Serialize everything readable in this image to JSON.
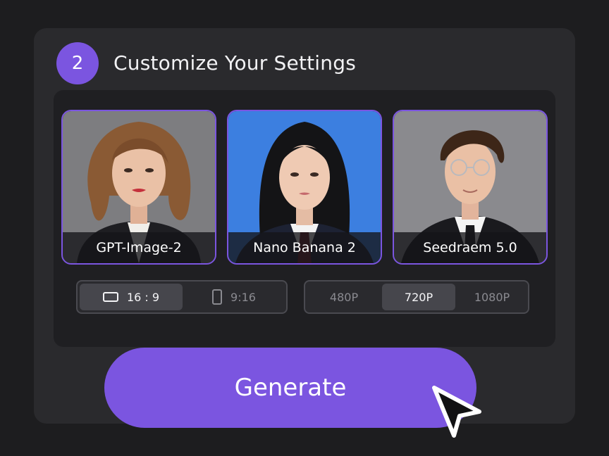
{
  "step": {
    "number": "2",
    "title": "Customize Your Settings"
  },
  "models": [
    {
      "label": "GPT-Image-2",
      "bg": "#7d7d80"
    },
    {
      "label": "Nano Banana 2",
      "bg": "#3c7fe0"
    },
    {
      "label": "Seedraem 5.0",
      "bg": "#8a8a8e"
    }
  ],
  "aspect_ratio": {
    "options": [
      "16 : 9",
      "9:16"
    ],
    "selected": "16 : 9"
  },
  "resolution": {
    "options": [
      "480P",
      "720P",
      "1080P"
    ],
    "selected": "720P"
  },
  "generate_label": "Generate",
  "colors": {
    "accent": "#7b55e0",
    "background": "#1d1d1f",
    "card": "#2a2a2d"
  }
}
